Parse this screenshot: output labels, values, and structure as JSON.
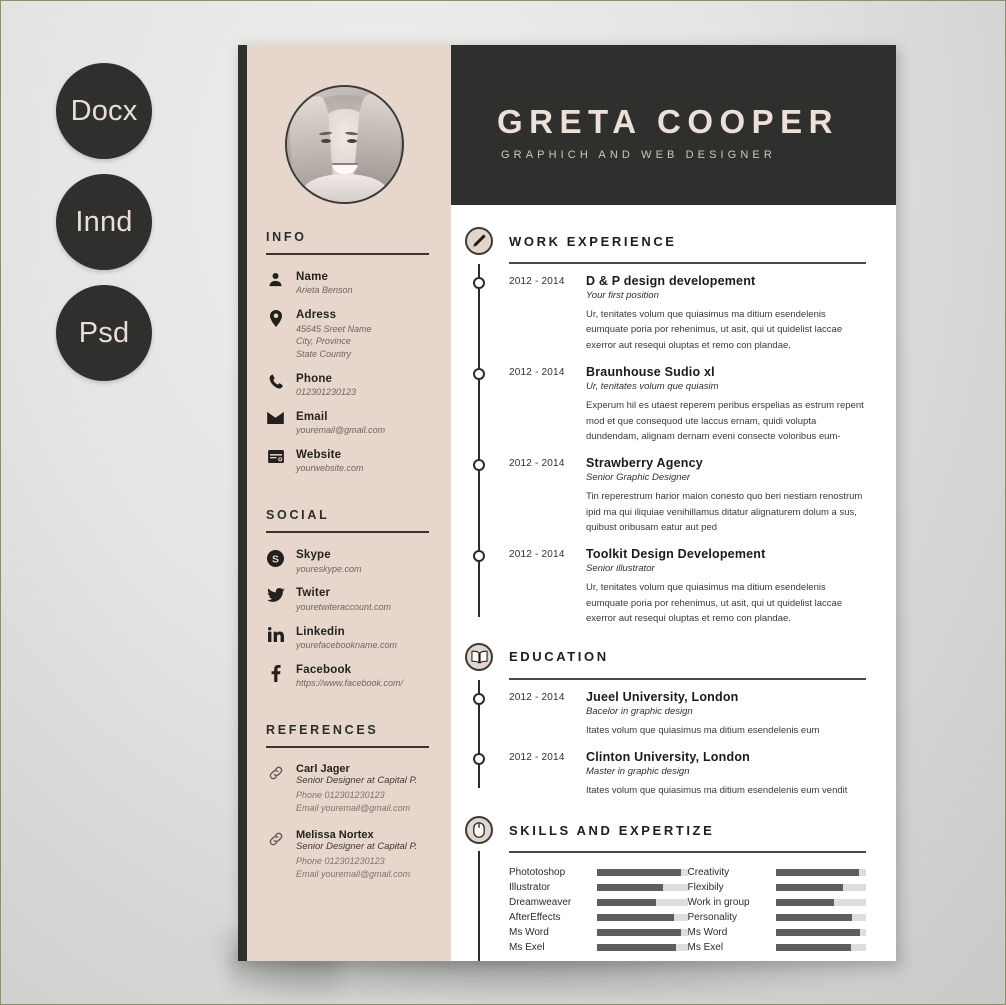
{
  "badges": [
    {
      "label": "Docx",
      "name": "badge-docx"
    },
    {
      "label": "Innd",
      "name": "badge-innd"
    },
    {
      "label": "Psd",
      "name": "badge-psd"
    }
  ],
  "colors": {
    "dark": "#2f2f2d",
    "beige": "#e6d6cc",
    "cream_text": "#ece0d8",
    "bar_fill": "#5e5e5c",
    "bar_track": "#dddddd",
    "backdrop": "#e3e3e1"
  },
  "header": {
    "name": "GRETA COOPER",
    "job_title": "GRAPHICH AND WEB DESIGNER",
    "photo_alt": "portrait-photo"
  },
  "sidebar": {
    "info": {
      "title": "INFO",
      "items": [
        {
          "icon": "person-icon",
          "label": "Name",
          "values": [
            "Arieta Benson"
          ]
        },
        {
          "icon": "location-icon",
          "label": "Adress",
          "values": [
            "45645 Sreet Name",
            "City, Province",
            "State Country"
          ]
        },
        {
          "icon": "phone-icon",
          "label": "Phone",
          "values": [
            "012301230123"
          ]
        },
        {
          "icon": "email-icon",
          "label": "Email",
          "values": [
            "youremail@gmail.com"
          ]
        },
        {
          "icon": "website-icon",
          "label": "Website",
          "values": [
            "yourwebsite.com"
          ]
        }
      ]
    },
    "social": {
      "title": "SOCIAL",
      "items": [
        {
          "icon": "skype-icon",
          "label": "Skype",
          "values": [
            "youreskype.com"
          ]
        },
        {
          "icon": "twitter-icon",
          "label": "Twiter",
          "values": [
            "youretwiteraccount.com"
          ]
        },
        {
          "icon": "linkedin-icon",
          "label": "Linkedin",
          "values": [
            "yourefacebookname.com"
          ]
        },
        {
          "icon": "facebook-icon",
          "label": "Facebook",
          "values": [
            "https://www.facebook.com/"
          ]
        }
      ]
    },
    "references": {
      "title": "REFERENCES",
      "items": [
        {
          "icon": "link-icon",
          "name": "Carl Jager",
          "role": "Senior Designer at Capital P.",
          "phone": "Phone 012301230123",
          "email": "Email youremail@gmail.com"
        },
        {
          "icon": "link-icon",
          "name": "Melissa Nortex",
          "role": "Senior Designer at Capital P.",
          "phone": "Phone 012301230123",
          "email": "Email youremail@gmail.com"
        }
      ]
    }
  },
  "work": {
    "title": "WORK EXPERIENCE",
    "icon": "pen-icon",
    "entries": [
      {
        "date": "2012 - 2014",
        "title": "D & P design developement",
        "subtitle": "Your first position",
        "desc": "Ur, tenitates volum que quiasimus ma ditium esendelenis eumquate poria por rehenimus, ut asit, qui ut quidelist laccae exerror aut resequi oluptas et remo con plandae."
      },
      {
        "date": "2012 - 2014",
        "title": "Braunhouse Sudio xl",
        "subtitle": "Ur, tenitates volum que quiasim",
        "desc": "Experum hil es utaest reperem peribus erspelias as estrum repent mod et que consequod ute laccus ernam, quidi volupta dundendam, alignam dernam eveni consecte voloribus eum-"
      },
      {
        "date": "2012 - 2014",
        "title": "Strawberry Agency",
        "subtitle": "Senior Graphic Designer",
        "desc": "Tin reperestrum harior maion conesto quo beri nestiam renostrum ipid ma qui iliquiae venihillamus ditatur alignaturem dolum a sus, quibust oribusam eatur aut ped"
      },
      {
        "date": "2012 - 2014",
        "title": "Toolkit Design Developement",
        "subtitle": "Senior illustrator",
        "desc": "Ur, tenitates volum que quiasimus ma ditium esendelenis eumquate poria por rehenimus, ut asit, qui ut quidelist laccae exerror aut resequi oluptas et remo con plandae."
      }
    ]
  },
  "education": {
    "title": "EDUCATION",
    "icon": "book-icon",
    "entries": [
      {
        "date": "2012 - 2014",
        "title": "Jueel University, London",
        "subtitle": "Bacelor in graphic design",
        "desc": "Itates volum que quiasimus ma ditium esendelenis eum"
      },
      {
        "date": "2012 - 2014",
        "title": "Clinton University, London",
        "subtitle": "Master in graphic design",
        "desc": "Itates volum que quiasimus ma ditium esendelenis eum vendit"
      }
    ]
  },
  "skills": {
    "title": "SKILLS AND EXPERTIZE",
    "icon": "mouse-icon",
    "left": [
      {
        "name": "Phototoshop",
        "value": 93
      },
      {
        "name": "Illustrator",
        "value": 73
      },
      {
        "name": "Dreamweaver",
        "value": 65
      },
      {
        "name": "AfterEffects",
        "value": 85
      },
      {
        "name": "Ms Word",
        "value": 93
      },
      {
        "name": "Ms Exel",
        "value": 87
      }
    ],
    "right": [
      {
        "name": "Creativity",
        "value": 92
      },
      {
        "name": "Flexibily",
        "value": 75
      },
      {
        "name": "Work in group",
        "value": 65
      },
      {
        "name": "Personality",
        "value": 85
      },
      {
        "name": "Ms Word",
        "value": 93
      },
      {
        "name": "Ms Exel",
        "value": 83
      }
    ]
  }
}
